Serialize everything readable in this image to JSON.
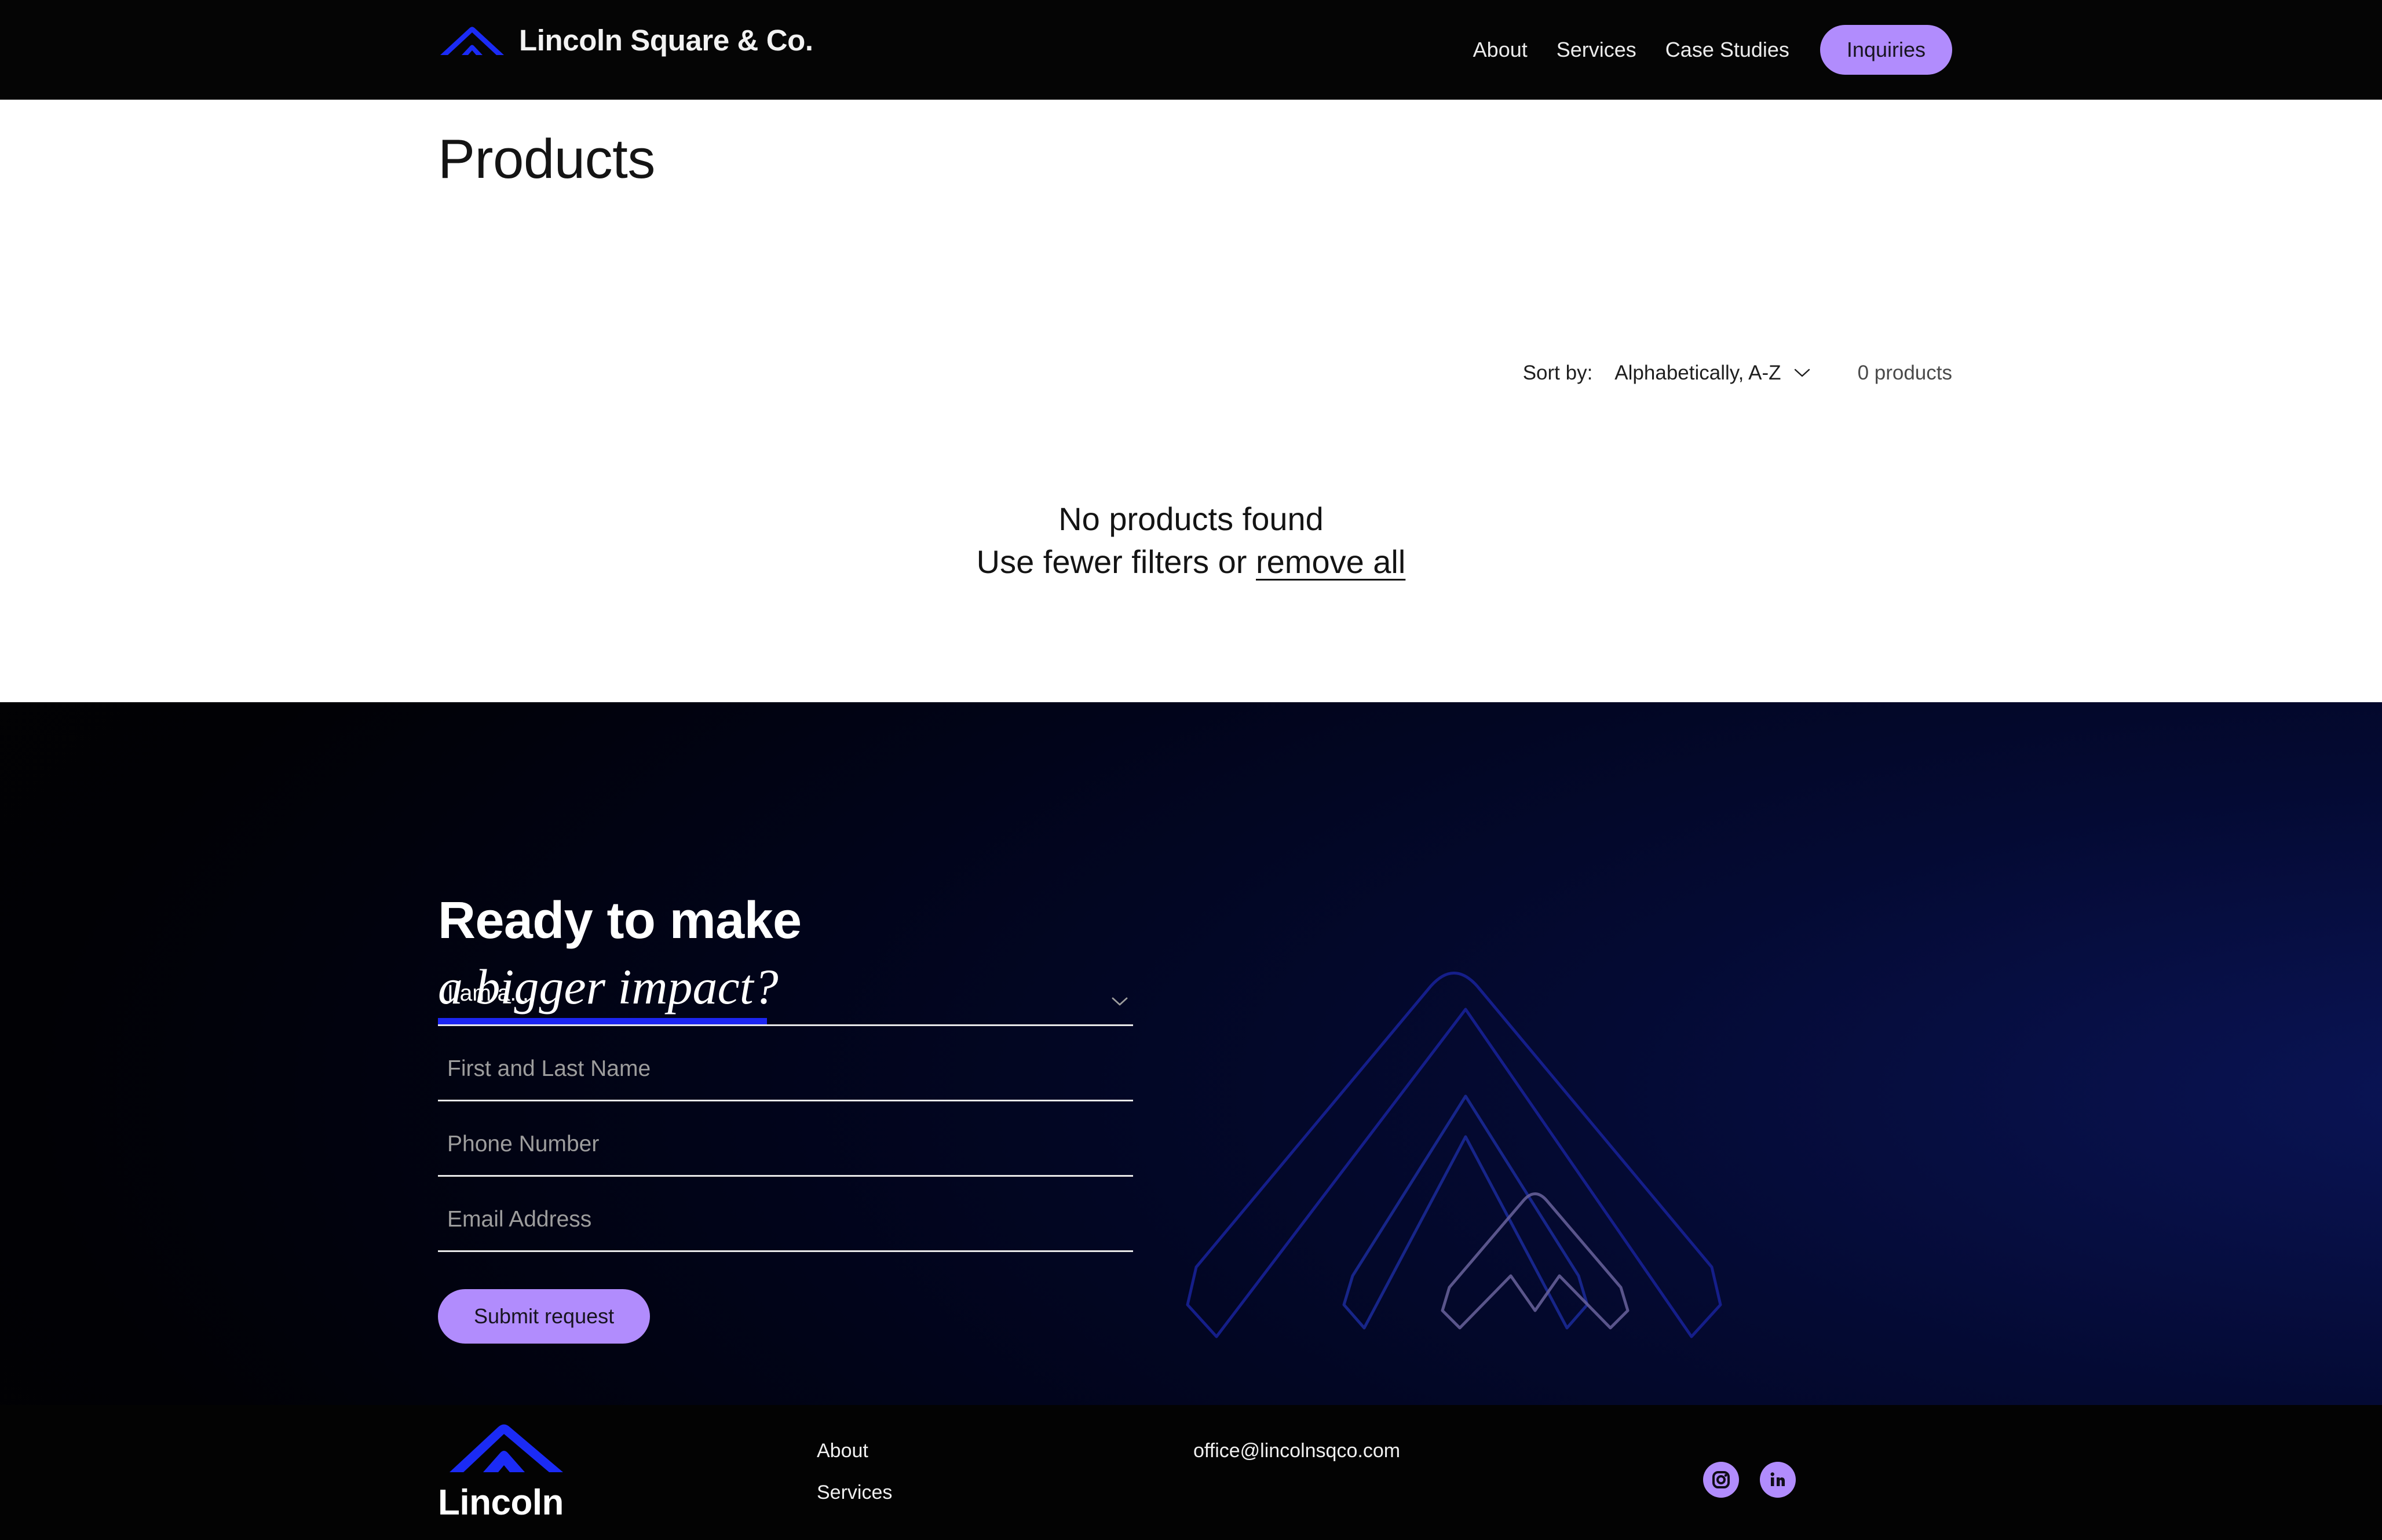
{
  "header": {
    "brand_name": "Lincoln Square & Co.",
    "logo_color": "#1b2bf5",
    "nav": [
      {
        "label": "About"
      },
      {
        "label": "Services"
      },
      {
        "label": "Case Studies"
      }
    ],
    "cta_label": "Inquiries",
    "cta_color": "#b18cfd",
    "background": "#050505"
  },
  "main": {
    "title": "Products",
    "toolbar": {
      "sort_label": "Sort by:",
      "sort_value": "Alphabetically, A-Z",
      "sort_options": [
        "Alphabetically, A-Z"
      ],
      "product_count": "0 products"
    },
    "empty_state": {
      "line_1": "No products found",
      "line_2_prefix": "Use fewer filters or ",
      "remove_all_label": "remove all"
    }
  },
  "footer": {
    "cta": {
      "line_1": "Ready to make",
      "line_2": "a bigger impact?",
      "underline_color": "#1c26f2"
    },
    "form": {
      "select_placeholder": "I am a...",
      "select_value": "",
      "name_placeholder": "First and Last Name",
      "name_value": "",
      "phone_placeholder": "Phone Number",
      "phone_value": "",
      "email_placeholder": "Email Address",
      "email_value": "",
      "submit_label": "Submit request"
    },
    "bottom": {
      "logo_word": "Lincoln",
      "links": [
        {
          "label": "About"
        },
        {
          "label": "Services"
        }
      ],
      "email": "office@lincolnsqco.com",
      "social": [
        {
          "name": "instagram"
        },
        {
          "name": "linkedin"
        }
      ]
    }
  }
}
